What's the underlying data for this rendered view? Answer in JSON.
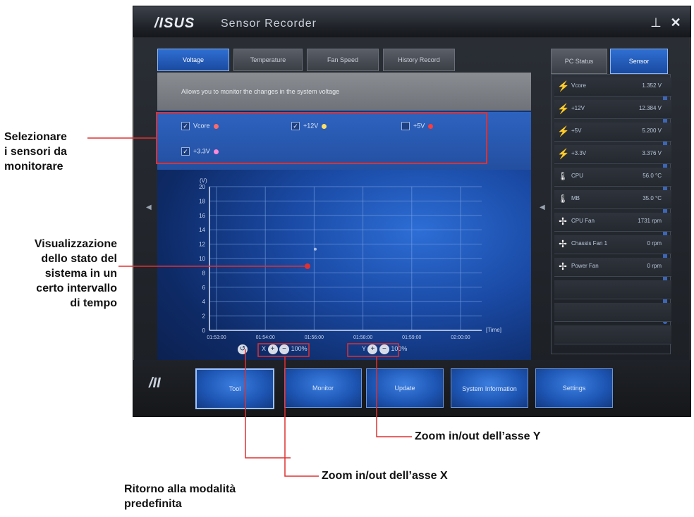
{
  "window": {
    "logo": "/ISUS",
    "title": "Sensor Recorder",
    "minimize_icon": "minimize-icon",
    "close_icon": "close-icon"
  },
  "tabs": [
    {
      "label": "Voltage",
      "active": true
    },
    {
      "label": "Temperature",
      "active": false
    },
    {
      "label": "Fan Speed",
      "active": false
    },
    {
      "label": "History Record",
      "active": false
    }
  ],
  "description": "Allows you to monitor the changes in the system voltage",
  "sensor_checkboxes": [
    {
      "label": "Vcore",
      "checked": true,
      "color": "#ff6b6b"
    },
    {
      "label": "+12V",
      "checked": true,
      "color": "#ffe066"
    },
    {
      "label": "+5V",
      "checked": false,
      "color": "#ff3b3b"
    },
    {
      "label": "+3.3V",
      "checked": true,
      "color": "#ff8ad8"
    }
  ],
  "chart_data": {
    "type": "line",
    "ylabel": "(V)",
    "xlabel": "[Time]",
    "y_ticks": [
      "0",
      "2",
      "4",
      "6",
      "8",
      "10",
      "12",
      "14",
      "16",
      "18",
      "20"
    ],
    "x_ticks": [
      "01:53:00",
      "01:54:00",
      "01:56:00",
      "01:58:00",
      "01:59:00",
      "02:00:00"
    ],
    "ylim": [
      0,
      20
    ],
    "grid": true,
    "series": [
      {
        "values": [
          11.3
        ]
      }
    ]
  },
  "chart_controls": {
    "reset_icon": "reset-icon",
    "x_zoom_prefix": "X",
    "x_zoom_percent": "100%",
    "y_zoom_prefix": "Y",
    "y_zoom_percent": "100%"
  },
  "right_tabs": [
    {
      "label": "PC Status",
      "active": false
    },
    {
      "label": "Sensor",
      "active": true
    }
  ],
  "sensors": [
    {
      "icon": "bolt-icon",
      "name": "Vcore",
      "value": "1.352 V"
    },
    {
      "icon": "bolt-icon",
      "name": "+12V",
      "value": "12.384 V"
    },
    {
      "icon": "bolt-icon",
      "name": "+5V",
      "value": "5.200 V"
    },
    {
      "icon": "bolt-icon",
      "name": "+3.3V",
      "value": "3.376 V"
    },
    {
      "icon": "thermometer-icon",
      "name": "CPU",
      "value": "56.0 °C"
    },
    {
      "icon": "thermometer-icon",
      "name": "MB",
      "value": "35.0 °C"
    },
    {
      "icon": "fan-icon",
      "name": "CPU Fan",
      "value": "1731 rpm"
    },
    {
      "icon": "fan-icon",
      "name": "Chassis Fan 1",
      "value": "0 rpm"
    },
    {
      "icon": "fan-icon",
      "name": "Power Fan",
      "value": "0 rpm"
    }
  ],
  "nav_buttons": [
    {
      "label": "Tool",
      "active": true
    },
    {
      "label": "Monitor",
      "active": false
    },
    {
      "label": "Update",
      "active": false
    },
    {
      "label": "System Information",
      "active": false
    },
    {
      "label": "Settings",
      "active": false
    }
  ],
  "annotations": {
    "select_sensors": [
      "Selezionare",
      "i sensori da",
      "monitorare"
    ],
    "visualization": [
      "Visualizzazione",
      "dello stato del",
      "sistema in un",
      "certo intervallo",
      "di tempo"
    ],
    "zoom_y": "Zoom in/out dell’asse Y",
    "zoom_x": "Zoom in/out dell’asse X",
    "reset": [
      "Ritorno alla modalità",
      "predefinita"
    ]
  },
  "colors": {
    "accent_blue": "#2f6fd3",
    "annotation_red": "#e03030"
  }
}
